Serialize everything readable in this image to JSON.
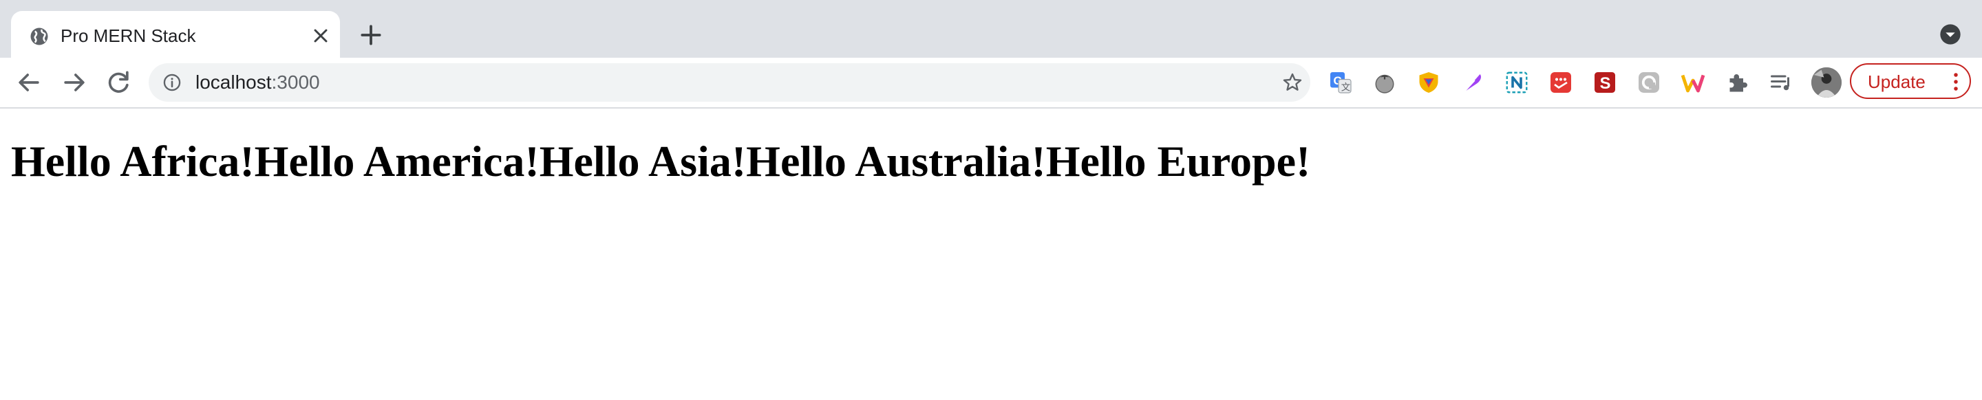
{
  "browser": {
    "tab": {
      "title": "Pro MERN Stack"
    },
    "address_bar": {
      "host": "localhost",
      "port": ":3000"
    },
    "update_button": {
      "label": "Update"
    },
    "extensions": [
      "google-translate-icon",
      "tomato-icon",
      "shield-extension-icon",
      "feather-pen-icon",
      "notion-n-icon",
      "calendar-extension-icon",
      "s-extension-icon",
      "grey-square-extension-icon",
      "w-extension-icon",
      "puzzle-piece-icon",
      "media-queue-icon"
    ],
    "colors": {
      "accent": "#c5221f",
      "tabstrip": "#dee1e6",
      "omnibox": "#f1f3f4"
    }
  },
  "page": {
    "greetings": [
      "Hello Africa!",
      "Hello America!",
      "Hello Asia!",
      "Hello Australia!",
      "Hello Europe!"
    ]
  }
}
